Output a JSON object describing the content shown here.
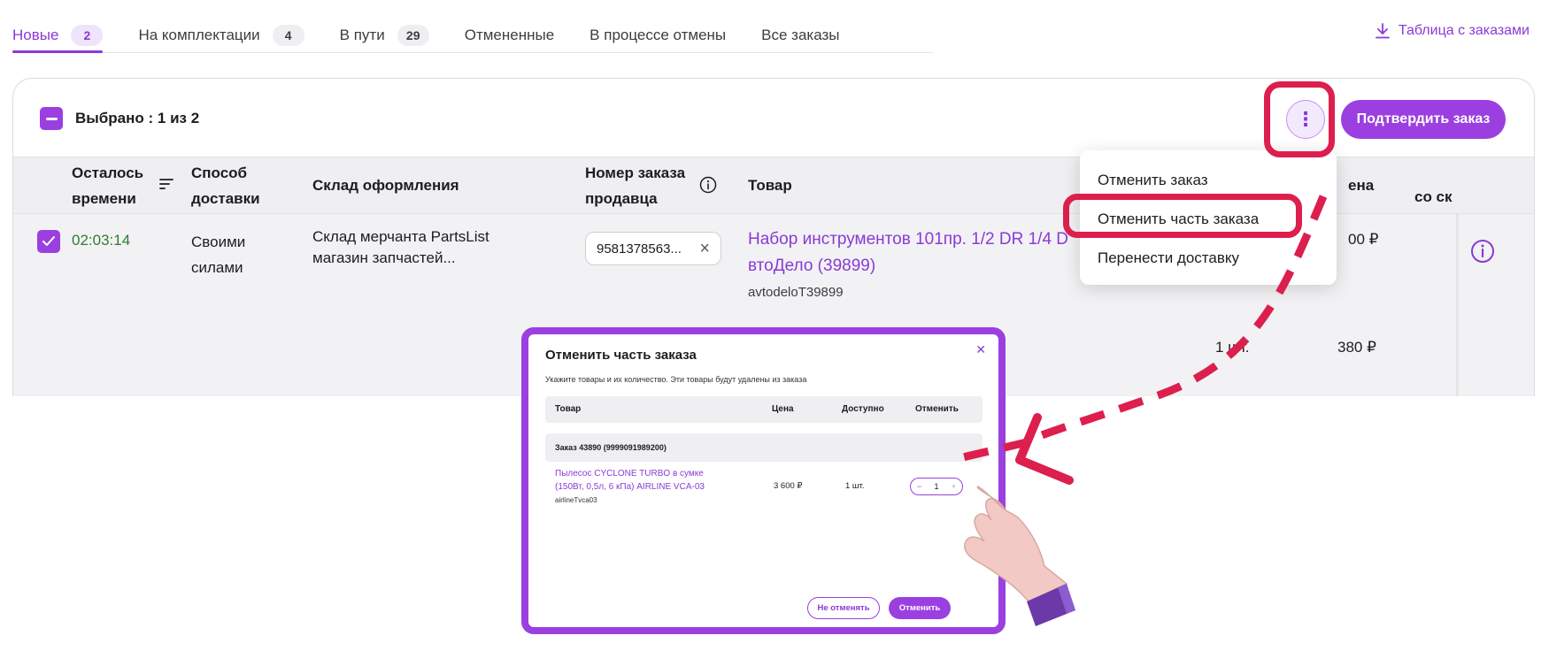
{
  "tabs": [
    {
      "label": "Новые",
      "count": "2"
    },
    {
      "label": "На комплектации",
      "count": "4"
    },
    {
      "label": "В пути",
      "count": "29"
    },
    {
      "label": "Отмененные"
    },
    {
      "label": "В процессе отмены"
    },
    {
      "label": "Все заказы"
    }
  ],
  "export_label": "Таблица с заказами",
  "bulk": {
    "selected_text": "Выбрано : 1 из 2",
    "more_icon": "⋮",
    "confirm_label": "Подтвердить заказ"
  },
  "columns": {
    "time_l1": "Осталось",
    "time_l2": "времени",
    "delivery_l1": "Способ",
    "delivery_l2": "доставки",
    "warehouse": "Склад оформления",
    "seller_l1": "Номер заказа",
    "seller_l2": "продавца",
    "product": "Товар",
    "price_partial": "ена",
    "discount_partial": "со ск"
  },
  "row": {
    "time": "02:03:14",
    "delivery_l1": "Своими",
    "delivery_l2": "силами",
    "warehouse_l1": "Склад мерчанта PartsList",
    "warehouse_l2": "магазин запчастей...",
    "seller_number": "9581378563...",
    "product_l1": "Набор инструментов 101пр. 1/2 DR 1/4 D",
    "product_l2": "втоДело (39899)",
    "sku": "avtodeloT39899",
    "price_partial": "00 ₽",
    "qty": "1 шт.",
    "price2": "380 ₽"
  },
  "menu": [
    "Отменить заказ",
    "Отменить часть заказа",
    "Перенести доставку"
  ],
  "modal": {
    "title": "Отменить часть заказа",
    "close_icon": "✕",
    "subtitle": "Укажите товары и их количество. Эти товары будут удалены из заказа",
    "headers": {
      "product": "Товар",
      "price": "Цена",
      "available": "Доступно",
      "cancel": "Отменить"
    },
    "order_label": "Заказ 43890 (9999091989200)",
    "product_name": "Пылесос CYCLONE TURBO в сумке (150Вт, 0,5л, 6 кПа) AIRLINE VCA-03",
    "product_sku": "airlineTvca03",
    "price": "3 600 ₽",
    "available": "1 шт.",
    "qty": "1",
    "minus": "−",
    "plus": "+",
    "btn_keep": "Не отменять",
    "btn_cancel": "Отменить"
  },
  "colors": {
    "accent": "#9b3fe0",
    "highlight": "#dc1f4d",
    "timer": "#2e7d32"
  }
}
